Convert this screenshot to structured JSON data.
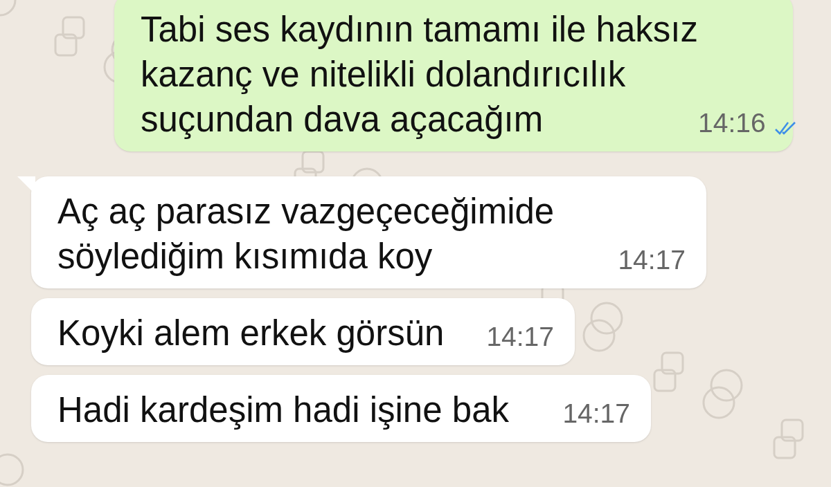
{
  "messages": [
    {
      "kind": "outgoing",
      "lines": [
        "Tabi ses kaydının tamamı ile haksız",
        "kazanç ve nitelikli dolandırıcılık",
        "suçundan dava açacağım"
      ],
      "time": "14:16",
      "read": true,
      "tail": false
    },
    {
      "kind": "incoming",
      "lines": [
        "Aç aç parasız vazgeçeceğimide",
        "söylediğim kısımıda koy"
      ],
      "time": "14:17",
      "tail": true
    },
    {
      "kind": "incoming",
      "lines": [
        "Koyki alem erkek görsün"
      ],
      "time": "14:17",
      "tail": false
    },
    {
      "kind": "incoming",
      "lines": [
        "Hadi kardeşim hadi işine bak"
      ],
      "time": "14:17",
      "tail": false
    }
  ]
}
